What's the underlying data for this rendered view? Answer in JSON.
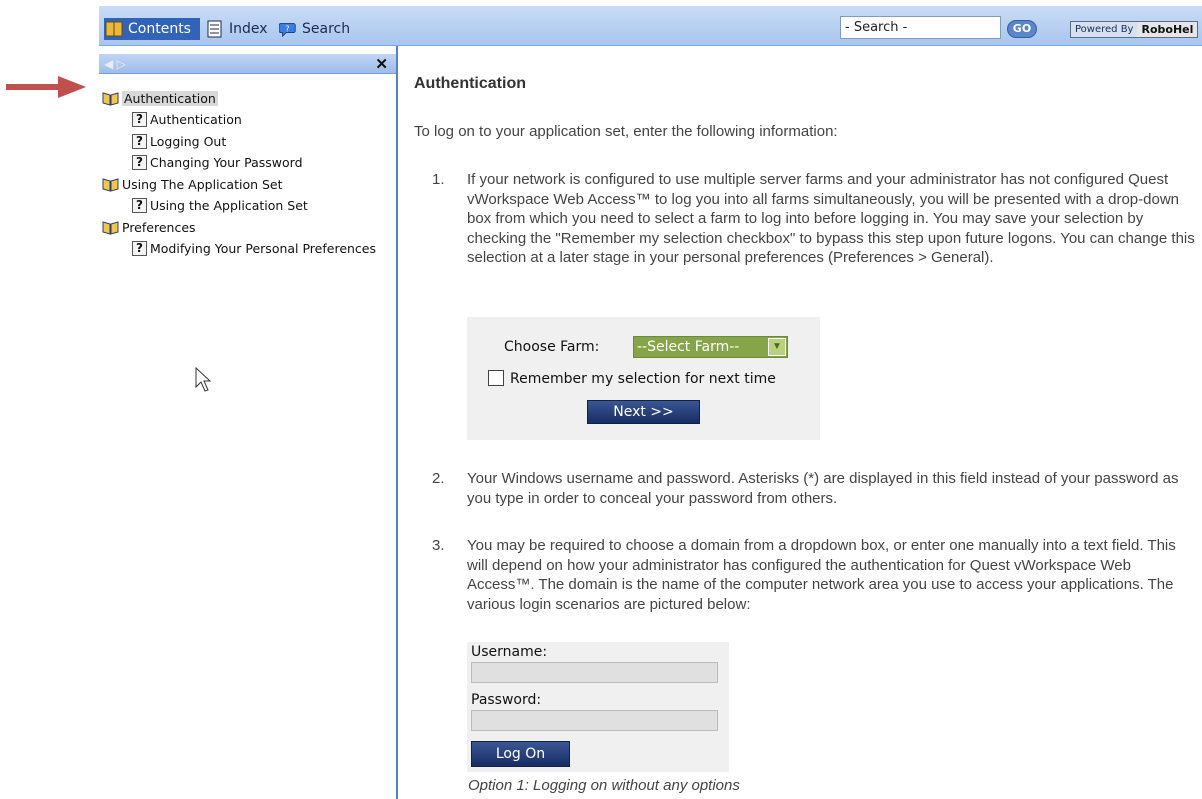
{
  "toolbar": {
    "tabs": [
      {
        "label": "Contents",
        "icon": "contents-icon"
      },
      {
        "label": "Index",
        "icon": "index-icon"
      },
      {
        "label": "Search",
        "icon": "search-icon"
      }
    ],
    "search_value": "- Search -",
    "go_label": "GO",
    "powered_by": "Powered By",
    "brand": "RoboHel"
  },
  "sidebar": {
    "tree": [
      {
        "label": "Authentication",
        "type": "book",
        "selected": true
      },
      {
        "label": "Authentication",
        "type": "topic"
      },
      {
        "label": "Logging Out",
        "type": "topic"
      },
      {
        "label": "Changing Your Password",
        "type": "topic"
      },
      {
        "label": "Using The Application Set",
        "type": "book"
      },
      {
        "label": "Using the Application Set",
        "type": "topic"
      },
      {
        "label": "Preferences",
        "type": "book"
      },
      {
        "label": "Modifying Your Personal Preferences",
        "type": "topic"
      }
    ]
  },
  "content": {
    "title": "Authentication",
    "intro": "To log on to your application set, enter the following information:",
    "steps": [
      {
        "num": "1.",
        "text": "If your network is configured to use multiple server farms and your administrator has not configured Quest vWorkspace Web Access™ to log you into all farms simultaneously, you will be presented with a drop-down box from which you need to select a farm to log into before logging in. You may save your selection by checking the \"Remember my selection checkbox\" to bypass this step upon future logons. You can change this selection at a later stage in your personal preferences (Preferences > General)."
      },
      {
        "num": "2.",
        "text": "Your Windows username and password. Asterisks (*) are displayed in this field instead of your password as you type in order to conceal your password from others."
      },
      {
        "num": "3.",
        "text": "You may be required to choose a domain from a dropdown box, or enter one manually into a text field. This will depend on how your administrator has configured the authentication for Quest vWorkspace Web Access™. The domain is the name of the computer network area you use to access your applications. The various login scenarios are pictured below:"
      }
    ],
    "farm_panel": {
      "label": "Choose Farm:",
      "select_value": "--Select Farm--",
      "remember_label": "Remember my selection for next time",
      "next_label": "Next >>"
    },
    "login_panel": {
      "username_label": "Username:",
      "password_label": "Password:",
      "logon_label": "Log On"
    },
    "caption": "Option 1: Logging on without any options"
  },
  "colors": {
    "arrow": "#c0504d",
    "toolbar": "#a9c6ee",
    "button": "#1f3570",
    "farm_select": "#86a548"
  }
}
